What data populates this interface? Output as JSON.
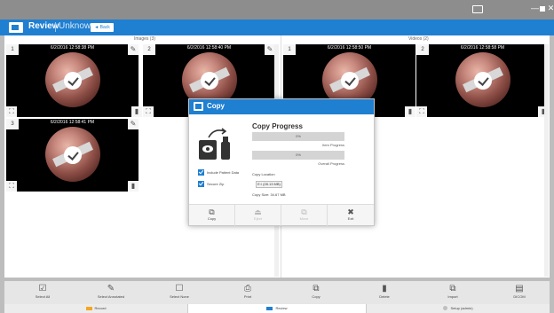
{
  "header": {
    "title": "Review",
    "patient": "Unknown",
    "back_label": "◄ Back"
  },
  "images_section": {
    "title": "Images (3)"
  },
  "videos_section": {
    "title": "Videos (2)"
  },
  "image_tiles": [
    {
      "number": "1",
      "timestamp": "6/2/2016 12:58:38 PM"
    },
    {
      "number": "2",
      "timestamp": "6/2/2016 12:58:40 PM"
    },
    {
      "number": "3",
      "timestamp": "6/2/2016 12:58:41 PM"
    }
  ],
  "video_tiles": [
    {
      "number": "1",
      "timestamp": "6/2/2016 12:58:50 PM"
    },
    {
      "number": "2",
      "timestamp": "6/2/2016 12:58:58 PM"
    }
  ],
  "dialog": {
    "title": "Copy",
    "progress_title": "Copy Progress",
    "item_progress": {
      "value": "0%",
      "label": "Item Progress"
    },
    "overall_progress": {
      "value": "0%",
      "label": "Overall Progress"
    },
    "include_patient_data": "Include Patient Data",
    "secure_zip": "Secure Zip",
    "copy_location_label": "Copy Location",
    "copy_location_value": "E:\\ (28.13 MB)",
    "copy_size": "Copy Size: 34.67 MB",
    "buttons": [
      {
        "label": "Copy",
        "enabled": true
      },
      {
        "label": "Eject",
        "enabled": false
      },
      {
        "label": "Move",
        "enabled": false
      },
      {
        "label": "Exit",
        "enabled": true
      }
    ]
  },
  "toolbar": {
    "select_all": "Select All",
    "select_annotated": "Select Annotated",
    "select_none": "Select None",
    "print": "Print",
    "copy": "Copy",
    "delete": "Delete",
    "import": "Import",
    "dicom": "DICOM"
  },
  "bottom_nav": {
    "record": "Record",
    "review": "Review",
    "setup": "Setup (admin)"
  },
  "colors": {
    "accent": "#1f7fd1",
    "record": "#f5a623",
    "setup": "#bfbfbf"
  }
}
